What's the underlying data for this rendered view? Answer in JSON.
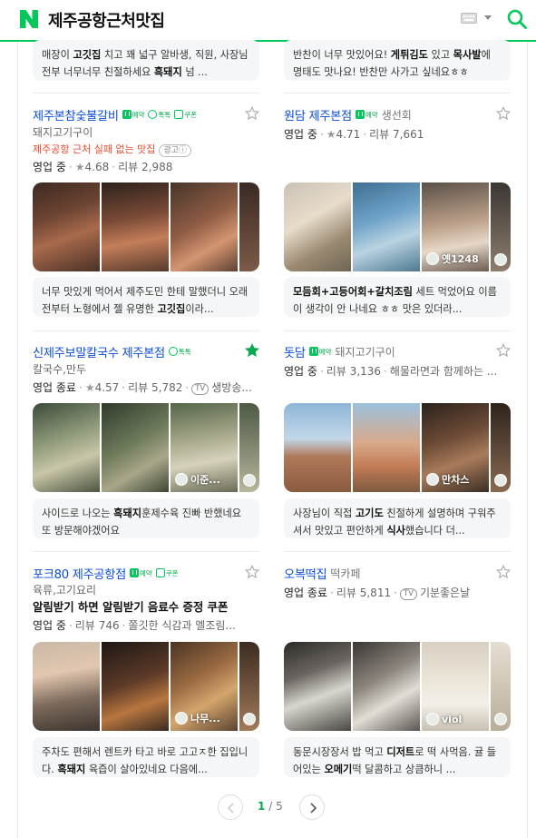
{
  "header": {
    "logo": "N",
    "query": "제주공항근처맛집",
    "brand_color": "#03c75a"
  },
  "top_reviews": [
    {
      "text_html": "매장이 <b>고깃집</b> 치고 꽤 넓구 알바생, 직원, 사장님 전부 너무너무 친절하세요 <b>흑돼지</b> 넘 ..."
    },
    {
      "text_html": "반찬이 너무 맛있어요! <b>게튀김도</b> 있고 <b>목사발</b>에 명태도 맛나요! 반찬만 사가고 싶네요ㅎㅎ"
    }
  ],
  "places": [
    {
      "name": "제주본참숯불갈비",
      "badges": [
        "예약",
        "톡톡",
        "쿠폰"
      ],
      "category": "돼지고기구이",
      "ad_text": "제주공항 근처 실패 없는 맛집",
      "ad_label": "광고ⓘ",
      "status": "영업 중",
      "rating": "4.68",
      "review_label": "리뷰",
      "reviews": "2,988",
      "photo_label": "",
      "review_html": "너무 맛있게 먹어서 제주도민 한테 말했더니 오래전부터 노형에서 젤 유명한 <b>고깃집</b>이라...",
      "saved": false
    },
    {
      "name": "원담 제주본점",
      "badges": [
        "예약"
      ],
      "category": "생선회",
      "status": "영업 중",
      "rating": "4.71",
      "review_label": "리뷰",
      "reviews": "7,661",
      "photo_label": "옛1248",
      "review_html": "<b>모듬회+고등어회+갈치조림</b> 세트 먹었어요 이름이 생각이 안 나네요 ㅎㅎ 맛은 있더라...",
      "saved": false
    },
    {
      "name": "신제주보말칼국수 제주본점",
      "badges": [
        "톡톡"
      ],
      "category": "칼국수,만두",
      "status": "영업 종료",
      "rating": "4.57",
      "review_label": "리뷰",
      "reviews": "5,782",
      "tv_text": "생방송...",
      "photo_label": "이준...",
      "review_html": "사이드로 나오는 <b>흑돼지</b>훈제수육 진빠 반했네요 또 방문해야겠어요",
      "saved": true
    },
    {
      "name": "돗담",
      "badges": [
        "예약"
      ],
      "category": "돼지고기구이",
      "status": "영업 중",
      "review_label": "리뷰",
      "reviews": "3,136",
      "extra": "해물라면과 함께하는 ...",
      "photo_label": "만차스",
      "review_html": "사장님이 직접 <b>고기도</b> 친절하게 설명하며 구워주셔서 맛있고 편안하게 <b>식사</b>했습니다 더...",
      "saved": false
    },
    {
      "name": "포크80 제주공항점",
      "badges": [
        "예약",
        "쿠폰"
      ],
      "category": "육류,고기요리",
      "promo": "알림받기 하면 알림받기 음료수 증정 쿠폰",
      "status": "영업 중",
      "review_label": "리뷰",
      "reviews": "746",
      "extra": "쫄깃한 식감과 멜조림...",
      "photo_label": "나무...",
      "review_html": "주차도 편해서 렌트카 타고 바로 고고ㅈ한 집입니다. <b>흑돼지</b> 육즙이 살아있네요 다음에...",
      "saved": false
    },
    {
      "name": "오복떡집",
      "badges": [],
      "category": "떡카페",
      "status": "영업 종료",
      "review_label": "리뷰",
      "reviews": "5,811",
      "tv_text": "기분좋은날",
      "photo_label": "viol",
      "review_html": "동문시장장서 밥 먹고 <b>디저트</b>로 떡 사먹음. 귤 들어있는 <b>오메기</b>떡 달콤하고 상큼하니 ...",
      "saved": false
    }
  ],
  "pagination": {
    "current": "1",
    "separator": "/",
    "total": "5"
  }
}
